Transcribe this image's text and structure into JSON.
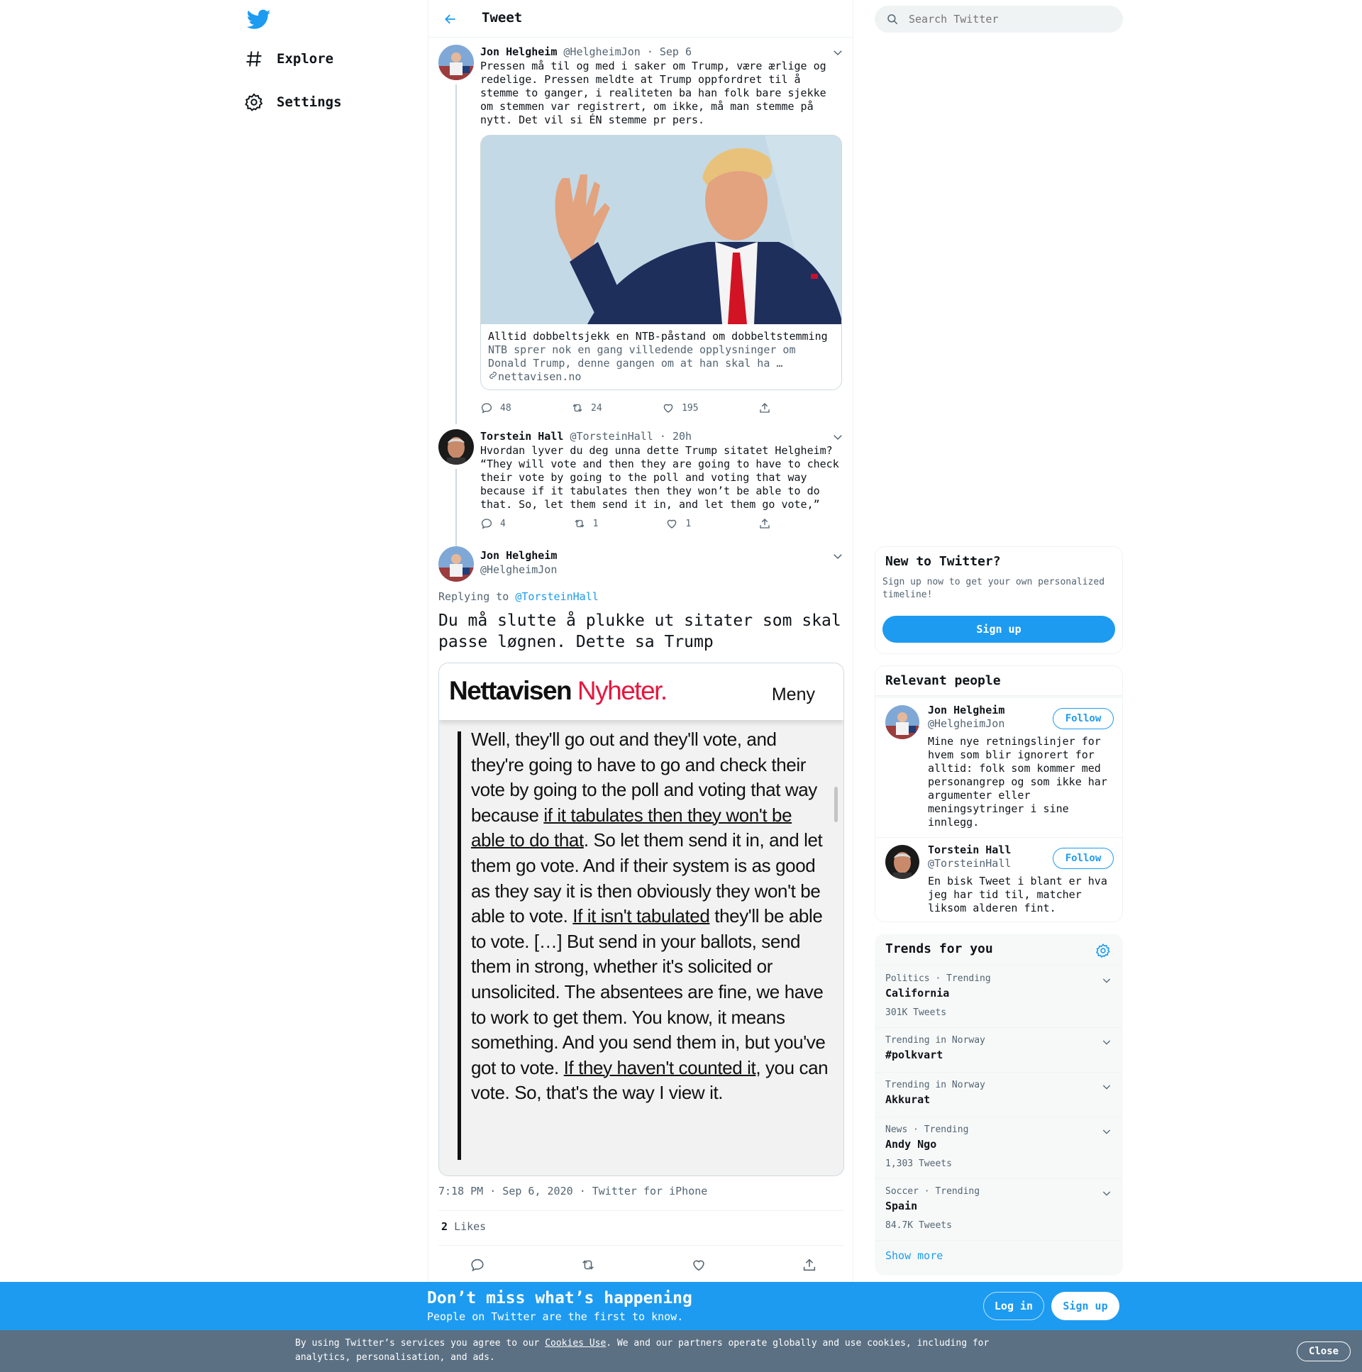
{
  "nav": {
    "explore_label": "Explore",
    "settings_label": "Settings"
  },
  "header": {
    "title": "Tweet"
  },
  "search": {
    "placeholder": "Search Twitter"
  },
  "thread": [
    {
      "name": "Jon Helgheim",
      "handle": "@HelgheimJon",
      "time": "Sep 6",
      "text": "Pressen må til og med i saker om Trump, være ærlige og\nredelige. Pressen meldte at Trump oppfordret til å\nstemme to ganger, i realiteten ba han folk bare sjekke\nom stemmen var registrert, om ikke, må man stemme på\nnytt. Det vil si ÉN stemme pr pers.",
      "card": {
        "title": "Alltid dobbeltsjekk en NTB-påstand om dobbeltstemming",
        "description": "NTB sprer nok en gang villedende opplysninger om\nDonald Trump, denne gangen om at han skal ha …",
        "domain": "nettavisen.no"
      },
      "replies": "48",
      "retweets": "24",
      "likes": "195"
    },
    {
      "name": "Torstein Hall",
      "handle": "@TorsteinHall",
      "time": "20h",
      "text": "Hvordan lyver du deg unna dette Trump sitatet Helgheim?\n“They will vote and then they are going to have to check\ntheir vote by going to the poll and voting that way\nbecause if it tabulates then they won’t be able to do\nthat. So, let them send it in, and let them go vote,”",
      "replies": "4",
      "retweets": "1",
      "likes": "1"
    }
  ],
  "main_tweet": {
    "name": "Jon Helgheim",
    "handle": "@HelgheimJon",
    "replying_prefix": "Replying to",
    "replying_to": "@TorsteinHall",
    "text": "Du må slutte å plukke ut sitater som skal\npasse løgnen. Dette sa Trump",
    "image": {
      "brand_black": "Nettavisen",
      "brand_red": "Nyheter.",
      "menu": "Meny",
      "quote_parts": [
        {
          "t": "Well, they'll go out and they'll vote, and they're going to have to go and check their vote by going to the poll and voting that way because ",
          "u": false
        },
        {
          "t": "if it tabulates then they won't be able to do that",
          "u": true
        },
        {
          "t": ". So let them send it in, and let them go vote. And if their system is as good as they say it is then obviously they won't be able to vote. ",
          "u": false
        },
        {
          "t": "If it isn't tabulated",
          "u": true
        },
        {
          "t": " they'll be able to vote. […] But send in your ballots, send them in strong, whether it's solicited or unsolicited. The absentees are fine, we have to work to get them. You know, it means something. And you send them in, but you've got to vote. ",
          "u": false
        },
        {
          "t": "If they haven't counted it",
          "u": true
        },
        {
          "t": ", you can vote. So, that's the way I view it.",
          "u": false
        }
      ]
    },
    "time": "7:18 PM · Sep 6, 2020",
    "source": "Twitter for iPhone",
    "likes_count": "2",
    "likes_label": "Likes"
  },
  "new_to_twitter": {
    "title": "New to Twitter?",
    "description": "Sign up now to get your own personalized timeline!",
    "signup_label": "Sign up"
  },
  "relevant_people": {
    "title": "Relevant people",
    "follow_label": "Follow",
    "people": [
      {
        "name": "Jon Helgheim",
        "handle": "@HelgheimJon",
        "bio": "Mine nye retningslinjer for hvem som blir ignorert for alltid: folk som kommer med personangrep og som ikke har argumenter eller meningsytringer i sine innlegg."
      },
      {
        "name": "Torstein Hall",
        "handle": "@TorsteinHall",
        "bio": "En bisk Tweet i blant er hva jeg har tid til, matcher liksom alderen fint."
      }
    ]
  },
  "trends": {
    "title": "Trends for you",
    "items": [
      {
        "meta": "Politics · Trending",
        "name": "California",
        "count": "301K Tweets"
      },
      {
        "meta": "Trending in Norway",
        "name": "#polkvart",
        "count": ""
      },
      {
        "meta": "Trending in Norway",
        "name": "Akkurat",
        "count": ""
      },
      {
        "meta": "News · Trending",
        "name": "Andy Ngo",
        "count": "1,303 Tweets"
      },
      {
        "meta": "Soccer · Trending",
        "name": "Spain",
        "count": "84.7K Tweets"
      }
    ],
    "show_more": "Show more"
  },
  "banner": {
    "title": "Don’t miss what’s happening",
    "subtitle": "People on Twitter are the first to know.",
    "login_label": "Log in",
    "signup_label": "Sign up"
  },
  "cookie": {
    "text_before": "By using Twitter’s services you agree to our ",
    "link": "Cookies Use",
    "text_after": ". We and our partners operate globally and use cookies, including for analytics, personalisation, and ads.",
    "close_label": "Close"
  },
  "colors": {
    "accent": "#1d9bf0",
    "text": "#0f1419",
    "muted": "#536471",
    "cookie_bg": "#5b7083",
    "brand_red": "#e5173f"
  }
}
